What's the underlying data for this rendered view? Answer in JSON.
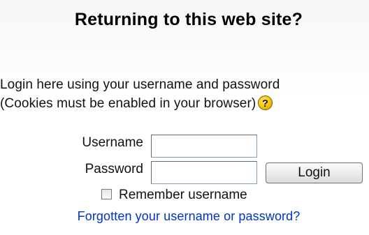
{
  "heading": "Returning to this web site?",
  "description": {
    "line1": "Login here using your username and password",
    "line2": "(Cookies must be enabled in your browser)"
  },
  "help_icon": {
    "icon": "help-question-icon",
    "glyph": "?",
    "color": "#f5c400"
  },
  "form": {
    "username_label": "Username",
    "username_value": "",
    "password_label": "Password",
    "password_value": "",
    "login_label": "Login",
    "remember_label": "Remember username",
    "remember_checked": false
  },
  "forgot_link": "Forgotten your username or password?",
  "colors": {
    "link": "#0033cc",
    "text": "#111111"
  }
}
